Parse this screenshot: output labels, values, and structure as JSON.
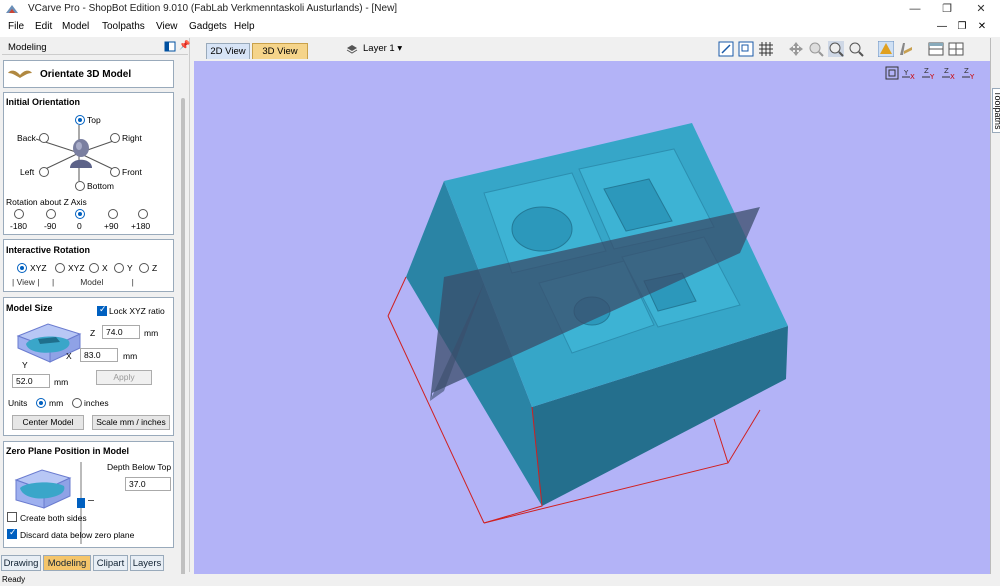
{
  "window": {
    "title": "VCarve Pro - ShopBot Edition 9.010 (FabLab Verkmenntaskoli Austurlands) - [New]",
    "min": "—",
    "max": "❐",
    "close": "✕"
  },
  "menu": [
    "File",
    "Edit",
    "Model",
    "Toolpaths",
    "View",
    "Gadgets",
    "Help"
  ],
  "mdi": {
    "min": "—",
    "restore": "❐",
    "close": "✕"
  },
  "panel": {
    "header": "Modeling",
    "orientate_title": "Orientate 3D Model",
    "initial": {
      "title": "Initial Orientation",
      "top": "Top",
      "back": "Back",
      "right": "Right",
      "left": "Left",
      "front": "Front",
      "bottom": "Bottom",
      "rot_title": "Rotation about Z Axis",
      "rot": [
        "-180",
        "-90",
        "0",
        "+90",
        "+180"
      ]
    },
    "interactive": {
      "title": "Interactive Rotation",
      "opts": [
        "XYZ",
        "XYZ",
        "X",
        "Y",
        "Z"
      ],
      "view": "View",
      "model": "Model"
    },
    "size": {
      "title": "Model Size",
      "lock": "Lock XYZ ratio",
      "z_lbl": "Z",
      "z": "74.0",
      "x_lbl": "X",
      "x": "83.0",
      "y_lbl": "Y",
      "y": "52.0",
      "unit": "mm",
      "apply": "Apply",
      "units": "Units",
      "mm": "mm",
      "inches": "inches",
      "center": "Center Model",
      "scale": "Scale mm / inches"
    },
    "zero": {
      "title": "Zero Plane Position in Model",
      "depth_lbl": "Depth Below Top",
      "depth": "37.0",
      "both": "Create both sides",
      "discard": "Discard data below zero plane"
    }
  },
  "bottom_tabs": [
    "Drawing",
    "Modeling",
    "Clipart",
    "Layers"
  ],
  "status": "Ready",
  "view_tabs": [
    "2D View",
    "3D View"
  ],
  "layer": "Layer 1 ▾",
  "side_tab": "Toolpaths",
  "colors": {
    "viewport": "#b3b3f7",
    "model_top": "#36a6c8",
    "model_front": "#2a84a5",
    "accent": "#f5c56a"
  }
}
